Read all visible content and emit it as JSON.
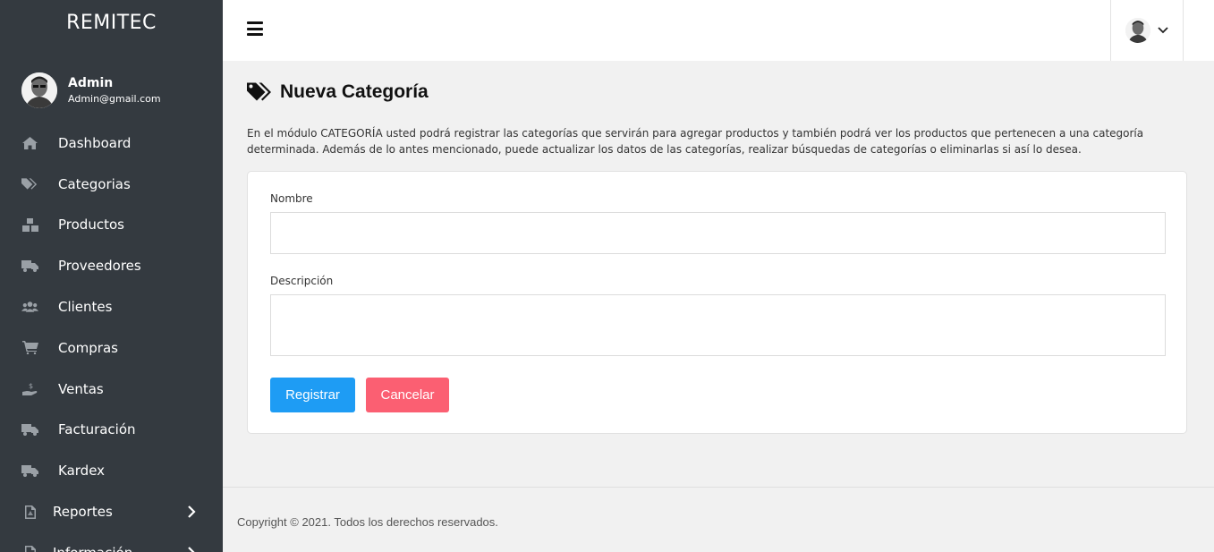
{
  "brand": "REMITEC",
  "user": {
    "name": "Admin",
    "email": "Admin@gmail.com"
  },
  "menu": [
    {
      "label": "Dashboard",
      "icon": "home-icon"
    },
    {
      "label": "Categorias",
      "icon": "tags-icon"
    },
    {
      "label": "Productos",
      "icon": "boxes-icon"
    },
    {
      "label": "Proveedores",
      "icon": "truck-icon"
    },
    {
      "label": "Clientes",
      "icon": "users-icon"
    },
    {
      "label": "Compras",
      "icon": "cart-icon"
    },
    {
      "label": "Ventas",
      "icon": "hand-dollar-icon"
    },
    {
      "label": "Facturación",
      "icon": "truck-icon"
    },
    {
      "label": "Kardex",
      "icon": "truck-icon"
    },
    {
      "label": "Reportes",
      "icon": "file-pdf-icon"
    },
    {
      "label": "Información",
      "icon": "file-icon"
    }
  ],
  "page": {
    "title": "Nueva Categoría",
    "description": "En el módulo CATEGORÍA usted podrá registrar las categorías que servirán para agregar productos y también podrá ver los productos que pertenecen a una categoría determinada. Además de lo antes mencionado, puede actualizar los datos de las categorías, realizar búsquedas de categorías o eliminarlas si así lo desea."
  },
  "form": {
    "nombre_label": "Nombre",
    "nombre_value": "",
    "descripcion_label": "Descripción",
    "descripcion_value": "",
    "register_label": "Registrar",
    "cancel_label": "Cancelar"
  },
  "footer": {
    "text": "Copyright © 2021. Todos los derechos reservados."
  },
  "colors": {
    "sidebar": "#343a40",
    "primary": "#1e9cf4",
    "danger": "#fb5f72",
    "background": "#f1f1f1"
  }
}
